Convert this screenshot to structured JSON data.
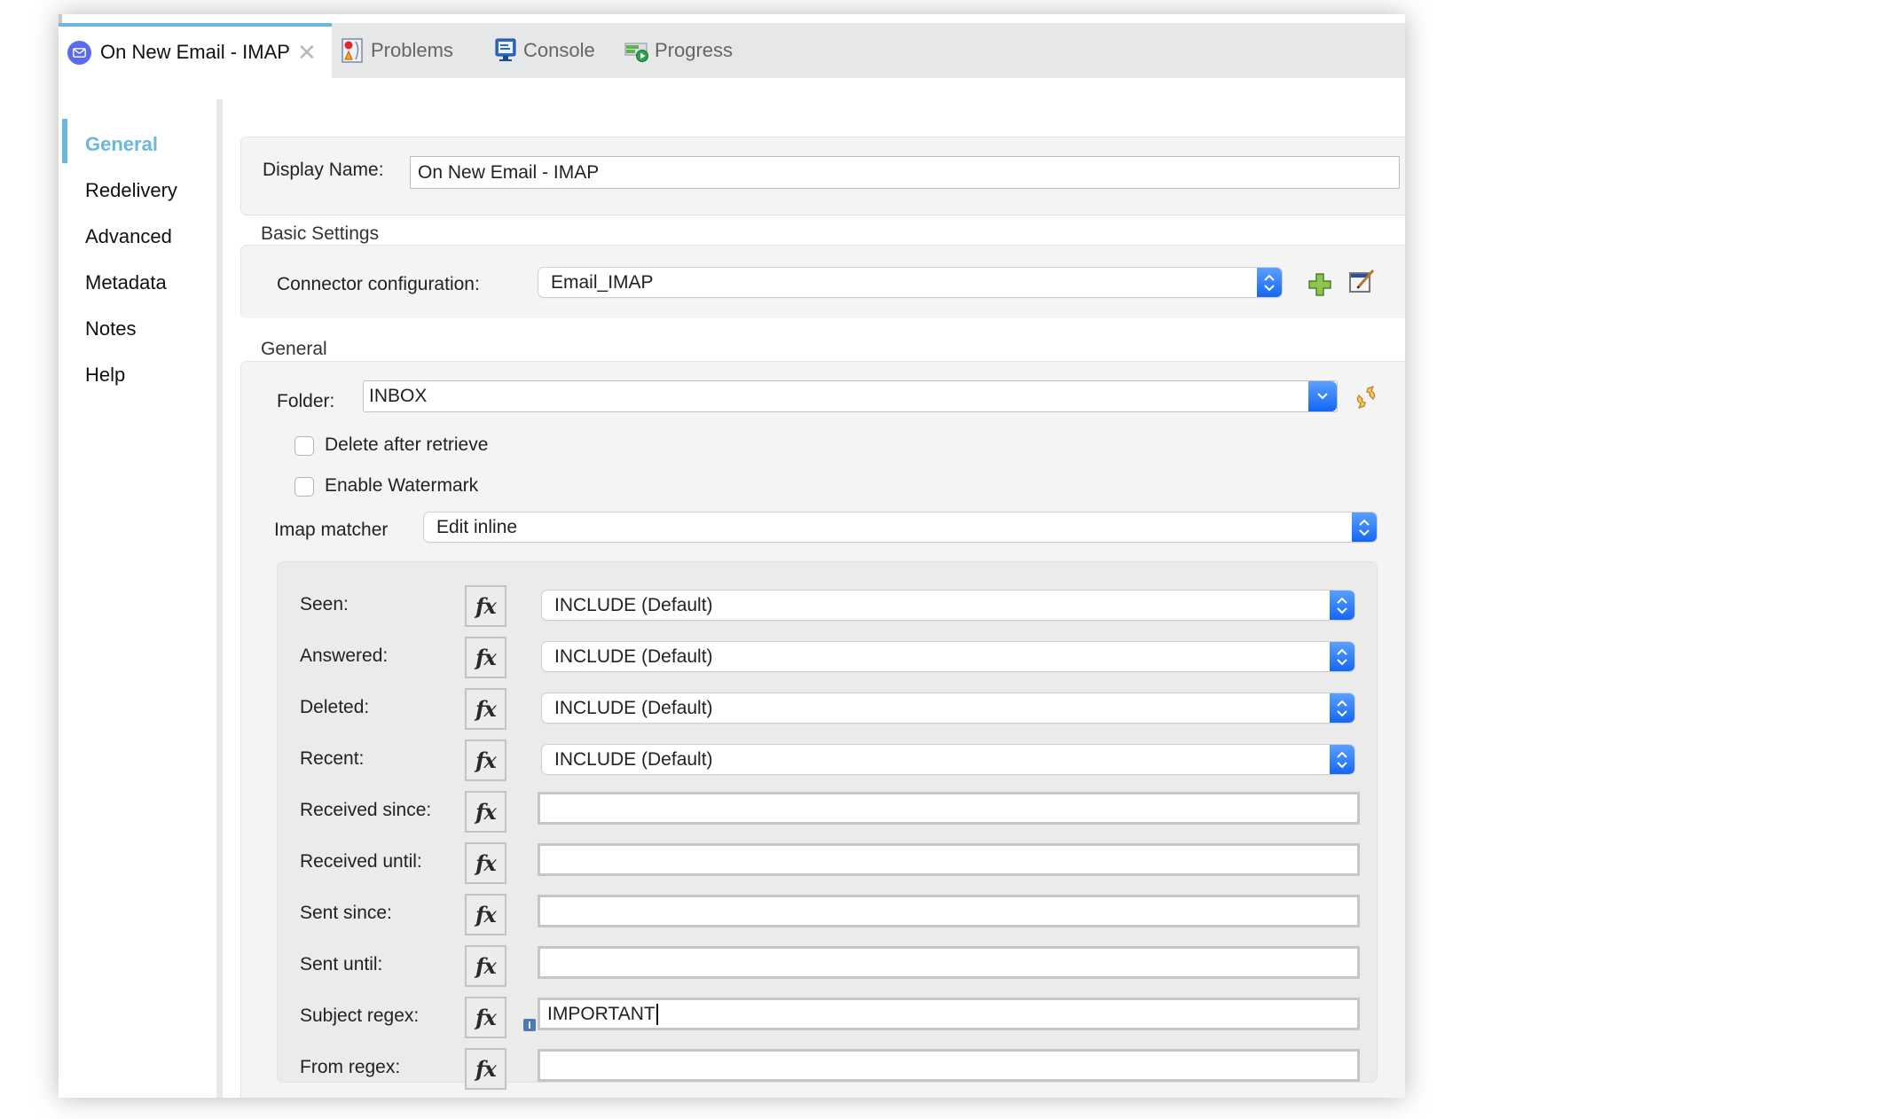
{
  "tabs": [
    {
      "label": "On New Email - IMAP",
      "icon": "email-icon",
      "active": true,
      "closable": true
    },
    {
      "label": "Problems",
      "icon": "problems-icon"
    },
    {
      "label": "Console",
      "icon": "console-icon"
    },
    {
      "label": "Progress",
      "icon": "progress-icon"
    }
  ],
  "sidebar": {
    "items": [
      {
        "label": "General",
        "active": true
      },
      {
        "label": "Redelivery"
      },
      {
        "label": "Advanced"
      },
      {
        "label": "Metadata"
      },
      {
        "label": "Notes"
      },
      {
        "label": "Help"
      }
    ]
  },
  "display_name": {
    "label": "Display Name:",
    "value": "On New Email - IMAP"
  },
  "basic_settings": {
    "title": "Basic Settings",
    "connector_label": "Connector configuration:",
    "connector_value": "Email_IMAP",
    "add_icon": "plus-icon",
    "edit_icon": "edit-icon"
  },
  "general": {
    "title": "General",
    "folder_label": "Folder:",
    "folder_value": "INBOX",
    "refresh_icon": "refresh-icon",
    "delete_after_retrieve": {
      "label": "Delete after retrieve",
      "checked": false
    },
    "enable_watermark": {
      "label": "Enable Watermark",
      "checked": false
    },
    "imap_matcher_label": "Imap matcher",
    "imap_matcher_value": "Edit inline"
  },
  "matcher": {
    "fx_label": "fx",
    "select_fields": [
      {
        "label": "Seen:",
        "value": "INCLUDE (Default)"
      },
      {
        "label": "Answered:",
        "value": "INCLUDE (Default)"
      },
      {
        "label": "Deleted:",
        "value": "INCLUDE (Default)"
      },
      {
        "label": "Recent:",
        "value": "INCLUDE (Default)"
      }
    ],
    "text_fields": [
      {
        "label": "Received since:",
        "value": ""
      },
      {
        "label": "Received until:",
        "value": ""
      },
      {
        "label": "Sent since:",
        "value": ""
      },
      {
        "label": "Sent until:",
        "value": ""
      },
      {
        "label": "Subject regex:",
        "value": "IMPORTANT",
        "info_badge": "i",
        "focused": true
      },
      {
        "label": "From regex:",
        "value": ""
      }
    ]
  },
  "colors": {
    "accent": "#6bb8dd",
    "select_button": "#1467f5",
    "email_badge": "#5a6bf2"
  }
}
